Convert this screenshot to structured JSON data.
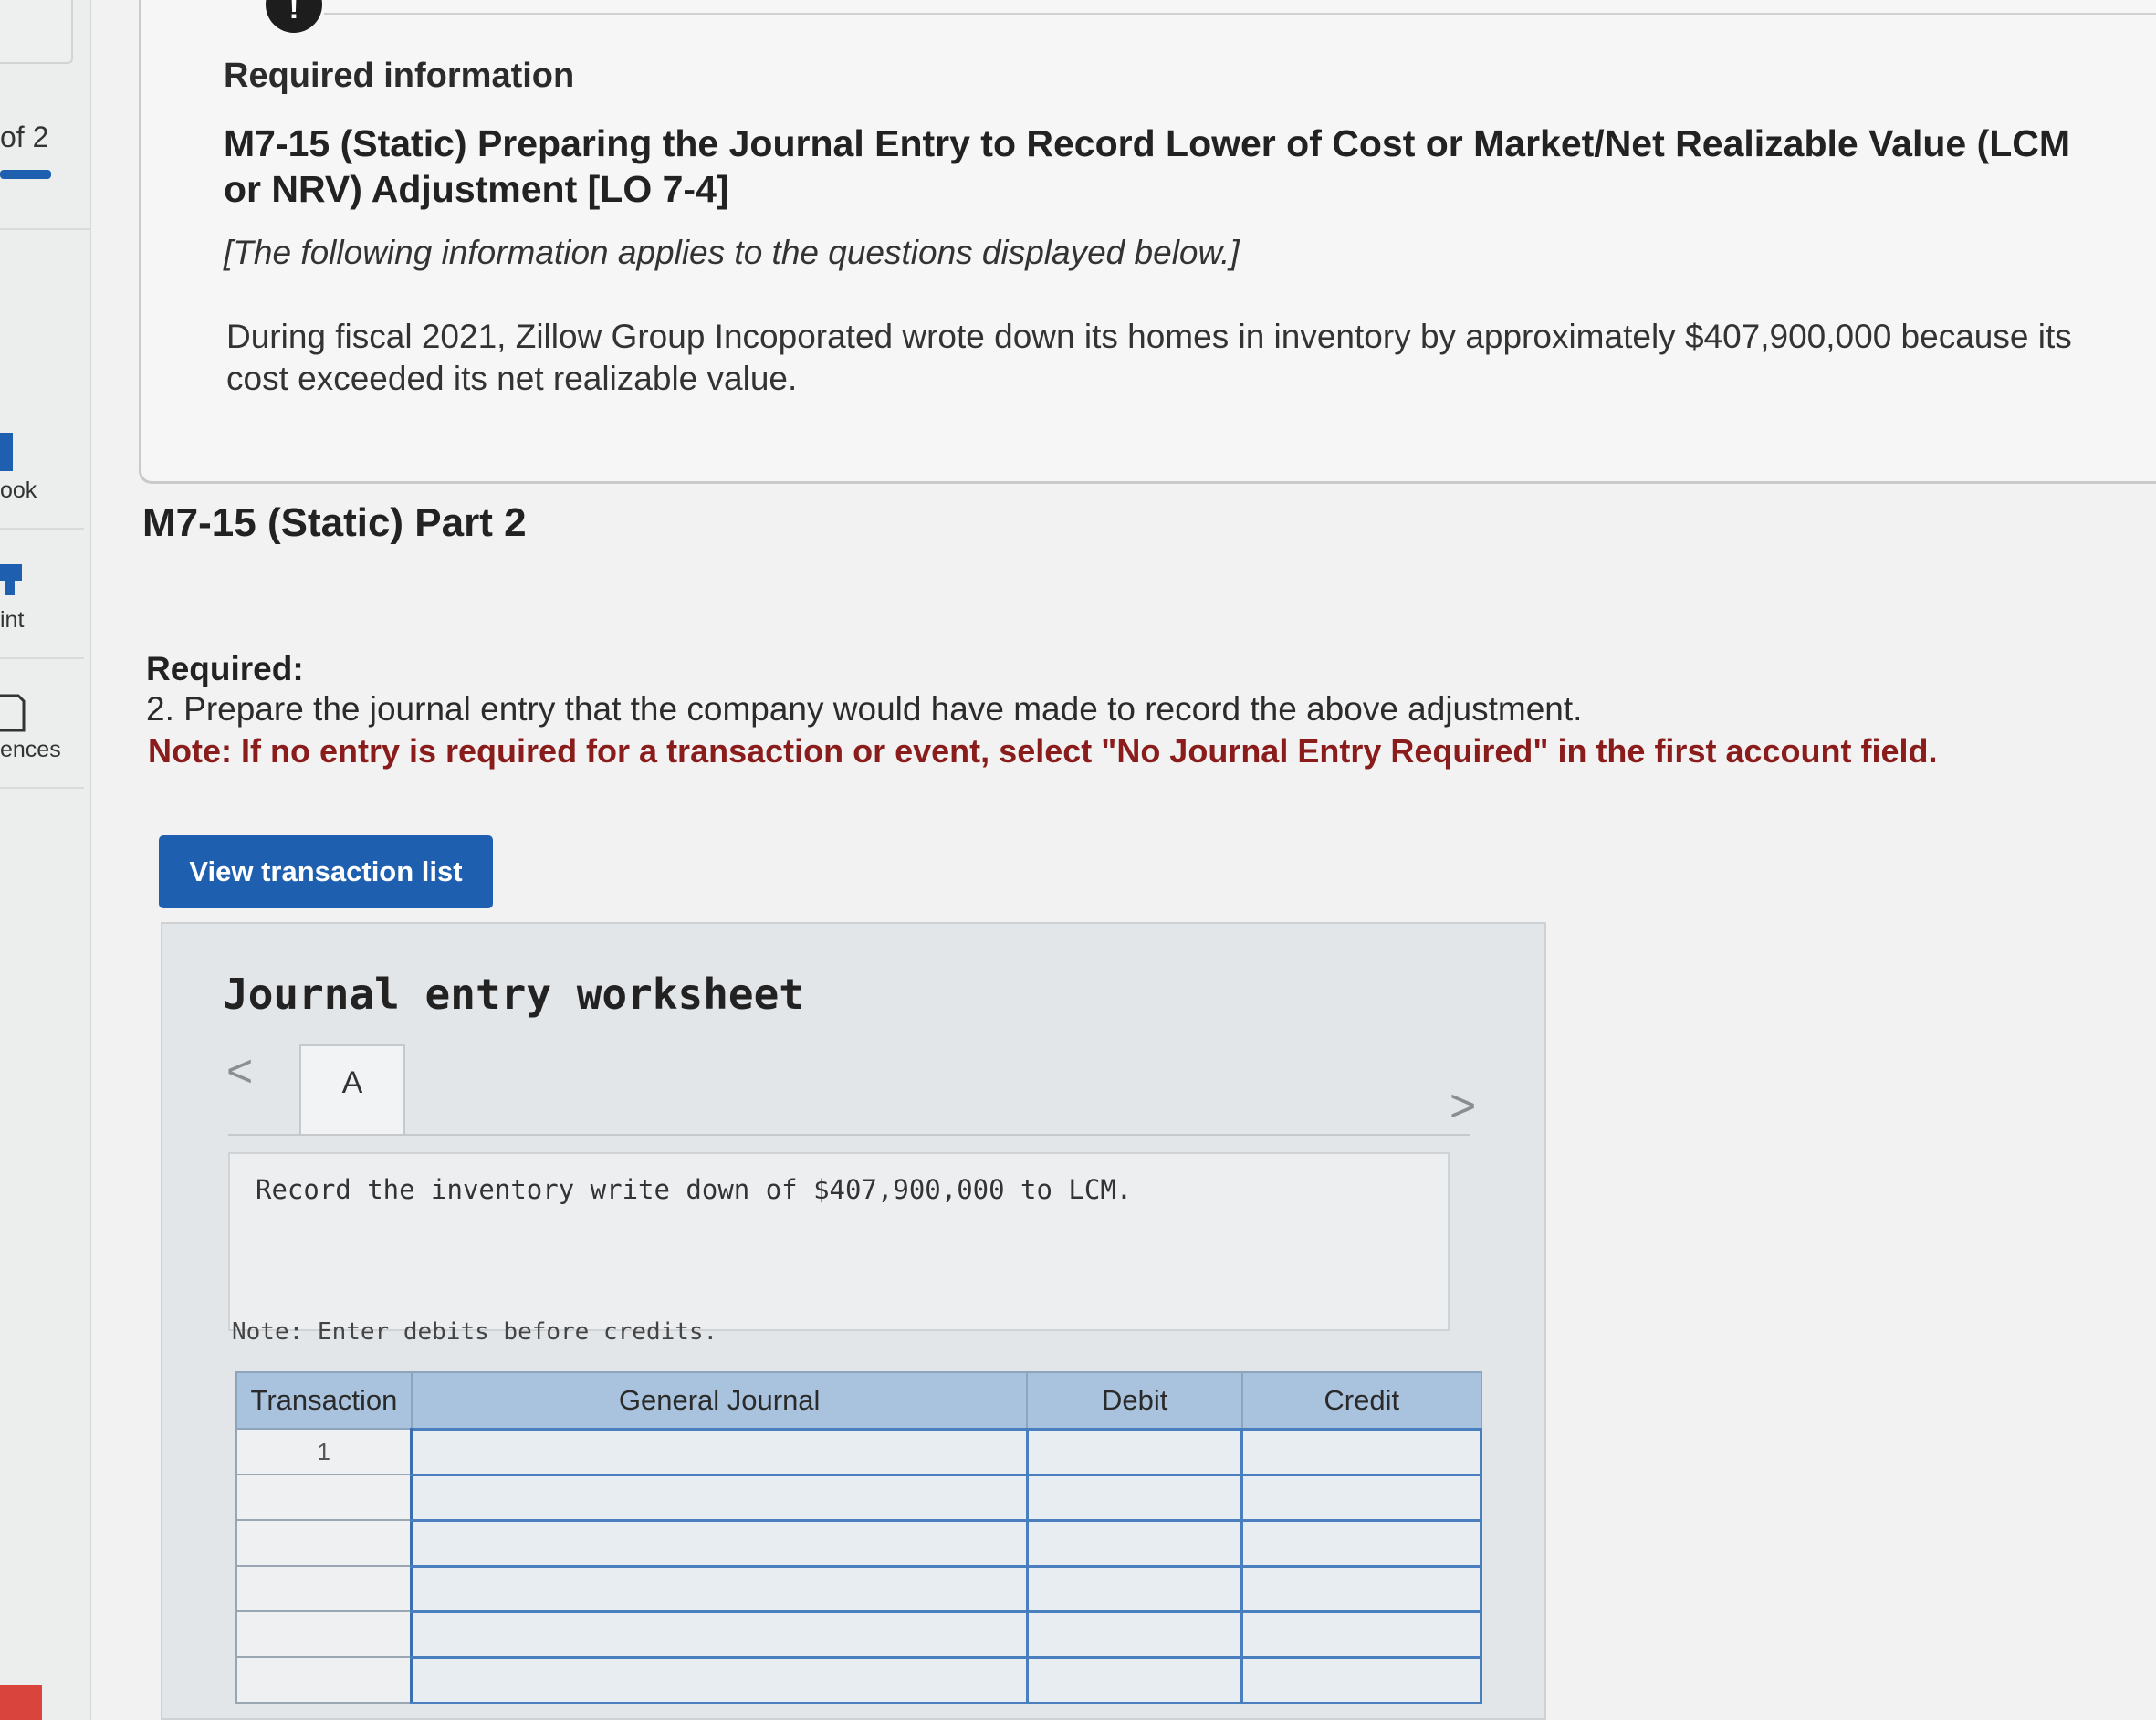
{
  "sidebar": {
    "pages": "of 2",
    "items": [
      {
        "label": "ook",
        "icon": "book-icon"
      },
      {
        "label": "int",
        "icon": "print-icon"
      },
      {
        "label": "ences",
        "icon": "references-icon"
      }
    ]
  },
  "info": {
    "badge": "!",
    "heading": "Required information",
    "title": "M7-15 (Static) Preparing the Journal Entry to Record Lower of Cost or Market/Net Realizable Value (LCM or NRV) Adjustment [LO 7-4]",
    "intro": "[The following information applies to the questions displayed below.]",
    "body": "During fiscal 2021, Zillow Group Incoporated wrote down its homes in inventory by approximately $407,900,000 because its cost exceeded its net realizable value."
  },
  "part": {
    "title": "M7-15 (Static) Part 2",
    "required_label": "Required:",
    "required_text": "2. Prepare the journal entry that the company would have made to record the above adjustment.",
    "note": "Note: If no entry is required for a transaction or event, select \"No Journal Entry Required\" in the first account field."
  },
  "buttons": {
    "view_transactions": "View transaction list"
  },
  "worksheet": {
    "title": "Journal entry worksheet",
    "prev_arrow": "<",
    "next_arrow": ">",
    "tab": "A",
    "instruction": "Record the inventory write down of $407,900,000 to LCM.",
    "note": "Note: Enter debits before credits.",
    "columns": [
      "Transaction",
      "General Journal",
      "Debit",
      "Credit"
    ],
    "rows": [
      {
        "transaction": "1"
      },
      {
        "transaction": ""
      },
      {
        "transaction": ""
      },
      {
        "transaction": ""
      },
      {
        "transaction": ""
      },
      {
        "transaction": ""
      }
    ]
  },
  "colors": {
    "accent": "#1f5fb0",
    "note_red": "#8a1c1c",
    "table_header": "#a9c3de"
  }
}
